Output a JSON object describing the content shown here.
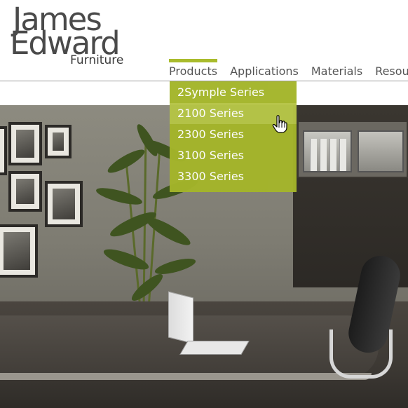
{
  "logo": {
    "line1": "James",
    "line2": "Edward",
    "line3": "Furniture"
  },
  "nav": {
    "items": [
      {
        "label": "Products",
        "active": true
      },
      {
        "label": "Applications",
        "active": false
      },
      {
        "label": "Materials",
        "active": false
      },
      {
        "label": "Resou",
        "active": false
      }
    ]
  },
  "dropdown": {
    "items": [
      {
        "label": "2Symple Series",
        "hover": false
      },
      {
        "label": "2100 Series",
        "hover": true
      },
      {
        "label": "2300 Series",
        "hover": false
      },
      {
        "label": "3100 Series",
        "hover": false
      },
      {
        "label": "3300 Series",
        "hover": false
      }
    ]
  },
  "colors": {
    "accent": "#a9bb2c",
    "dropdown_bg": "#a4b52a",
    "dropdown_hover": "#b5c446",
    "nav_text": "#555555"
  },
  "icons": {
    "cursor": "hand-pointer-icon"
  }
}
